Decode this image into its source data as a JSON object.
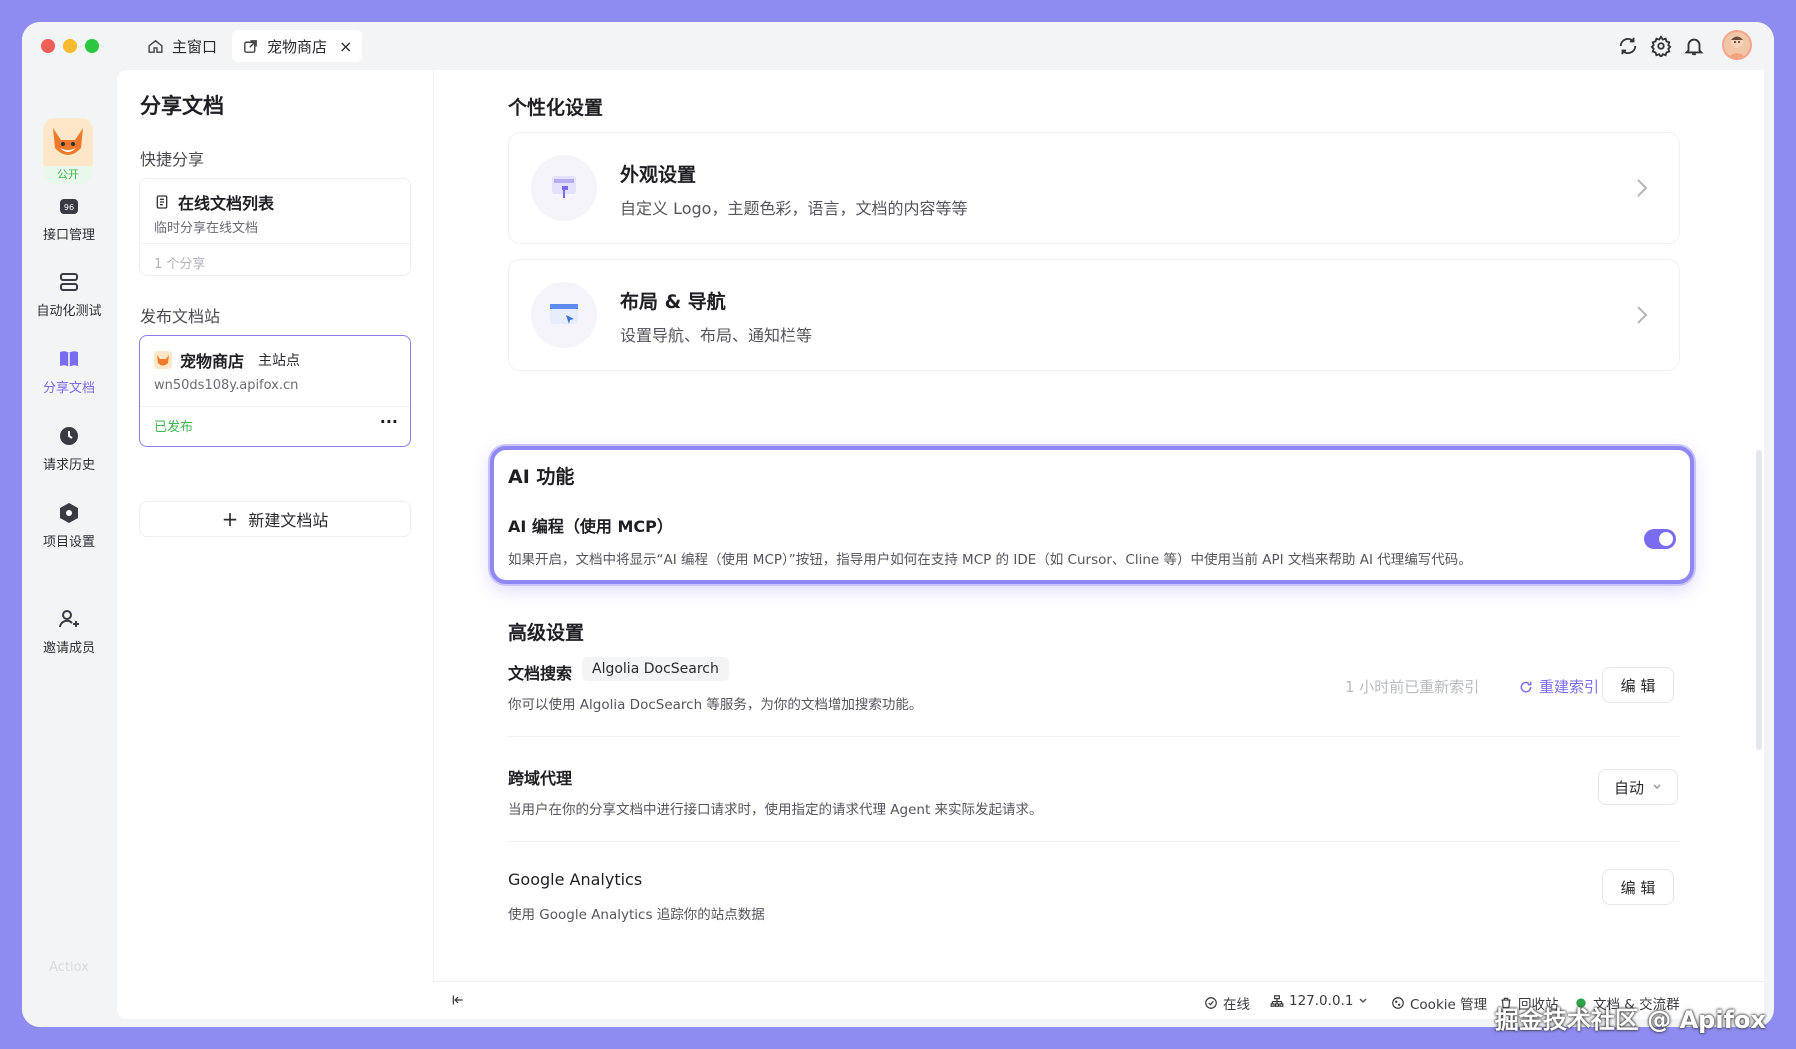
{
  "titlebar": {
    "tabs": [
      {
        "label": "主窗口",
        "icon": "home-icon"
      },
      {
        "label": "宠物商店",
        "icon": "external-doc-icon"
      }
    ],
    "close_symbol": "×"
  },
  "leftnav": {
    "project_tag": "公开",
    "items": [
      {
        "label": "接口管理",
        "icon": "api-icon"
      },
      {
        "label": "自动化测试",
        "icon": "database-icon"
      },
      {
        "label": "分享文档",
        "icon": "book-icon"
      },
      {
        "label": "请求历史",
        "icon": "clock-icon"
      },
      {
        "label": "项目设置",
        "icon": "settings-hex-icon"
      },
      {
        "label": "邀请成员",
        "icon": "add-user-icon"
      }
    ],
    "brand_faint": "Actiox"
  },
  "panel": {
    "title": "分享文档",
    "quick_share": "快捷分享",
    "online_doc": {
      "title": "在线文档列表",
      "subtitle": "临时分享在线文档",
      "footer": "1 个分享"
    },
    "publish_site": "发布文档站",
    "site_card": {
      "name": "宠物商店",
      "tag": "主站点",
      "url": "wn50ds108y.apifox.cn",
      "status": "已发布",
      "more": "···"
    },
    "new_site": "新建文档站",
    "new_site_plus": "+"
  },
  "main": {
    "personalization_title": "个性化设置",
    "appearance": {
      "title": "外观设置",
      "desc": "自定义 Logo，主题色彩，语言，文档的内容等等"
    },
    "layout": {
      "title": "布局 & 导航",
      "desc": "设置导航、布局、通知栏等"
    },
    "ai": {
      "title": "AI 功能",
      "item": "AI 编程（使用 MCP）",
      "desc": "如果开启，文档中将显示“AI 编程（使用 MCP）”按钮，指导用户如何在支持 MCP 的 IDE（如 Cursor、Cline 等）中使用当前 API 文档来帮助 AI 代理编写代码。",
      "enabled": true
    },
    "advanced_title": "高级设置",
    "doc_search": {
      "label": "文档搜索",
      "tag": "Algolia DocSearch",
      "desc": "你可以使用 Algolia DocSearch 等服务，为你的文档增加搜索功能。",
      "index_status": "1 小时前已重新索引",
      "reindex": "重建索引",
      "edit": "编 辑"
    },
    "cors_proxy": {
      "label": "跨域代理",
      "desc": "当用户在你的分享文档中进行接口请求时，使用指定的请求代理 Agent 来实际发起请求。",
      "value": "自动"
    },
    "google_analytics": {
      "label": "Google Analytics",
      "desc": "使用 Google Analytics 追踪你的站点数据",
      "edit": "编 辑"
    }
  },
  "statusbar": {
    "online": "在线",
    "host": "127.0.0.1",
    "cookie": "Cookie 管理",
    "recycle": "回收站",
    "docs": "文档 & 交流群"
  },
  "watermark": "掘金技术社区 @ Apifox",
  "colors": {
    "accent": "#7a6cf0",
    "frame": "#8e8cf0",
    "published": "#3fb34f"
  }
}
